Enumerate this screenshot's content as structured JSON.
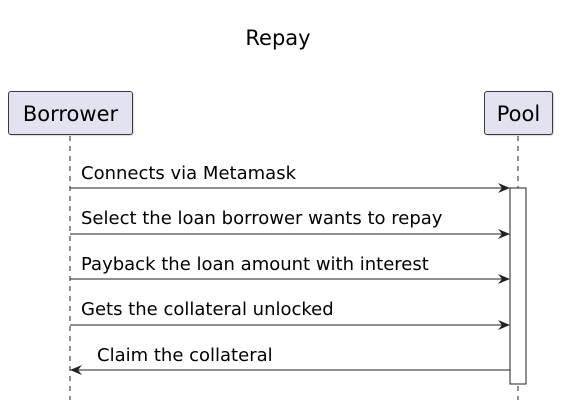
{
  "title": "Repay",
  "participants": [
    {
      "id": "borrower",
      "label": "Borrower"
    },
    {
      "id": "pool",
      "label": "Pool"
    }
  ],
  "messages": [
    {
      "from": "borrower",
      "to": "pool",
      "label": "Connects via Metamask"
    },
    {
      "from": "borrower",
      "to": "pool",
      "label": "Select the loan borrower wants to repay"
    },
    {
      "from": "borrower",
      "to": "pool",
      "label": "Payback the loan amount with interest"
    },
    {
      "from": "borrower",
      "to": "pool",
      "label": "Gets the collateral unlocked"
    },
    {
      "from": "pool",
      "to": "borrower",
      "label": "Claim the collateral"
    }
  ],
  "colors": {
    "participant_fill": "#e2e2f0",
    "participant_border": "#3a3a3a",
    "line": "#222222",
    "activation_fill": "#ffffff"
  }
}
